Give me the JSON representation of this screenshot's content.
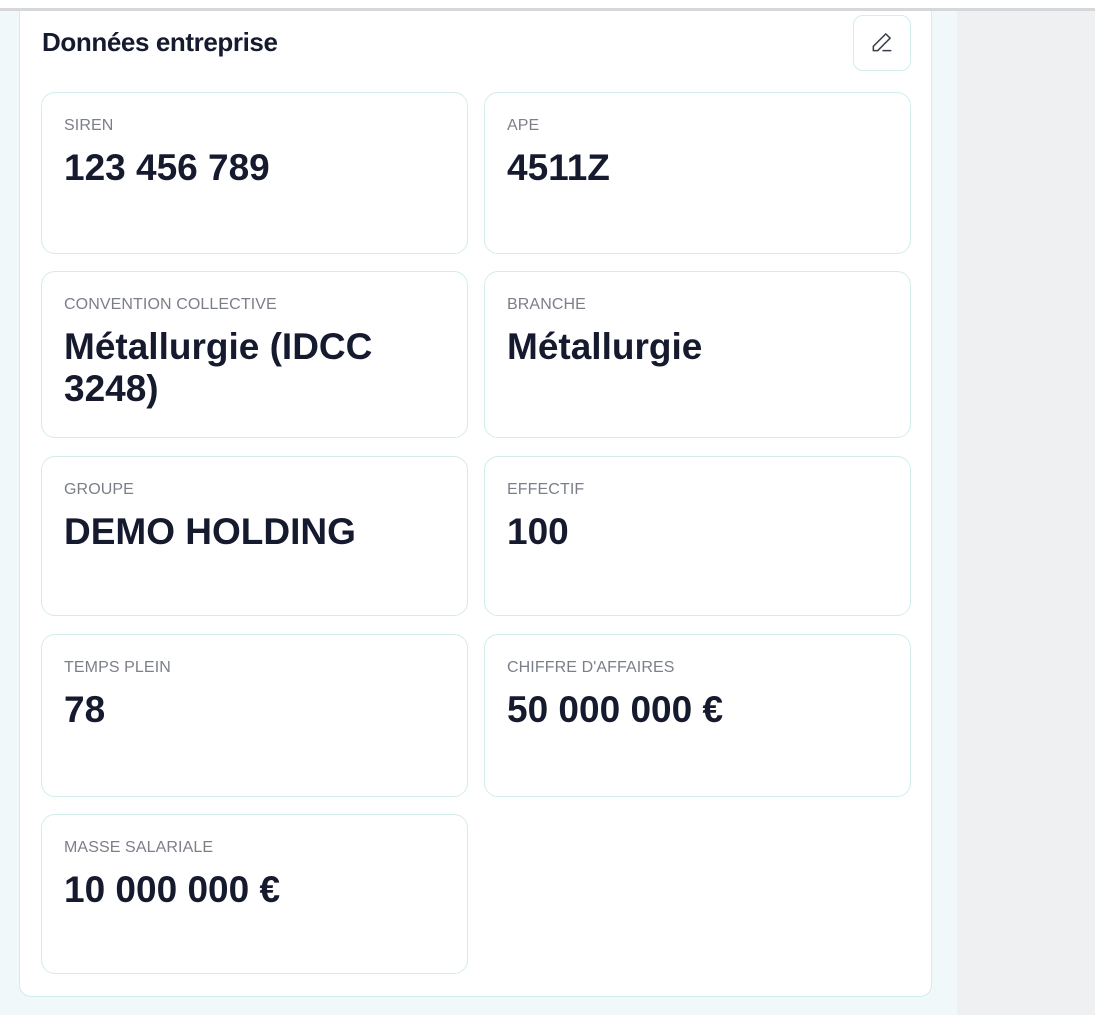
{
  "section": {
    "title": "Données entreprise",
    "edit_icon": "pencil-icon"
  },
  "fields": [
    {
      "key": "siren",
      "label": "SIREN",
      "value": "123 456 789"
    },
    {
      "key": "ape",
      "label": "APE",
      "value": "4511Z"
    },
    {
      "key": "convention",
      "label": "CONVENTION COLLECTIVE",
      "value": "Métallurgie (IDCC 3248)"
    },
    {
      "key": "branche",
      "label": "BRANCHE",
      "value": "Métallurgie"
    },
    {
      "key": "groupe",
      "label": "GROUPE",
      "value": "DEMO HOLDING"
    },
    {
      "key": "effectif",
      "label": "EFFECTIF",
      "value": "100"
    },
    {
      "key": "temps-plein",
      "label": "TEMPS PLEIN",
      "value": "78"
    },
    {
      "key": "chiffre-affaires",
      "label": "CHIFFRE D'AFFAIRES",
      "value": "50 000 000 €"
    },
    {
      "key": "masse-salariale",
      "label": "MASSE SALARIALE",
      "value": "10 000 000 €"
    }
  ],
  "colors": {
    "text": "#161a2e",
    "label": "#7b7f88",
    "border": "#d3ecec",
    "panel": "#f1f8f9"
  }
}
